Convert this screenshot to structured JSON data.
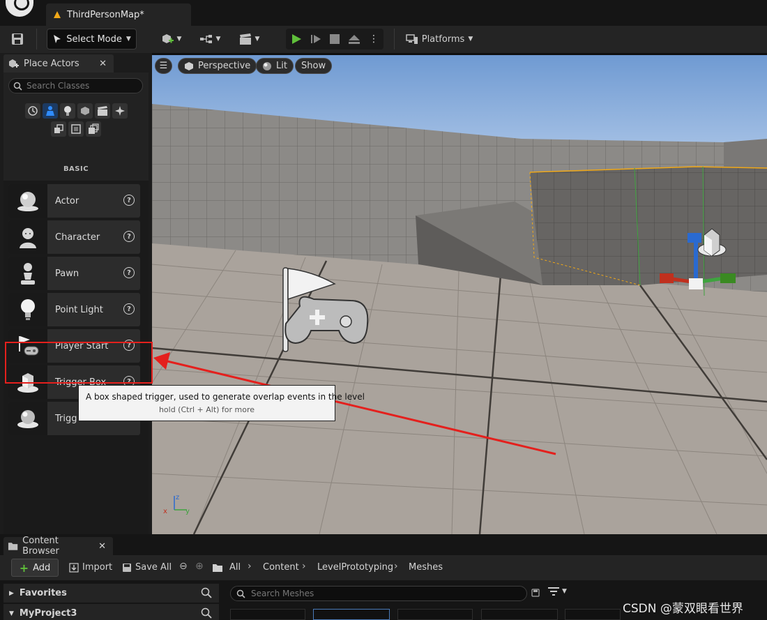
{
  "tab": {
    "title": "ThirdPersonMap*"
  },
  "toolbar": {
    "select_mode": "Select Mode",
    "platforms": "Platforms"
  },
  "place_actors": {
    "title": "Place Actors",
    "search_placeholder": "Search Classes",
    "section": "BASIC",
    "items": [
      {
        "label": "Actor",
        "icon": "sphere-icon"
      },
      {
        "label": "Character",
        "icon": "character-icon"
      },
      {
        "label": "Pawn",
        "icon": "pawn-icon"
      },
      {
        "label": "Point Light",
        "icon": "lightbulb-icon"
      },
      {
        "label": "Player Start",
        "icon": "player-start-icon"
      },
      {
        "label": "Trigger Box",
        "icon": "trigger-box-icon"
      },
      {
        "label": "Trigg",
        "icon": "trigger-sphere-icon"
      }
    ]
  },
  "viewport": {
    "perspective": "Perspective",
    "lit": "Lit",
    "show": "Show"
  },
  "tooltip": {
    "text": "A box shaped trigger, used to generate overlap events in the level",
    "hint": "hold (Ctrl + Alt) for more"
  },
  "content_browser": {
    "title": "Content Browser",
    "add": "Add",
    "import": "Import",
    "save_all": "Save All",
    "breadcrumb": [
      "All",
      "Content",
      "LevelPrototyping",
      "Meshes"
    ],
    "favorites": "Favorites",
    "project": "MyProject3",
    "search_placeholder": "Search Meshes"
  },
  "watermark": "CSDN @蒙双眼看世界",
  "colors": {
    "highlight": "#e4201d",
    "play": "#5fbf3a",
    "selection": "#f0a818"
  }
}
